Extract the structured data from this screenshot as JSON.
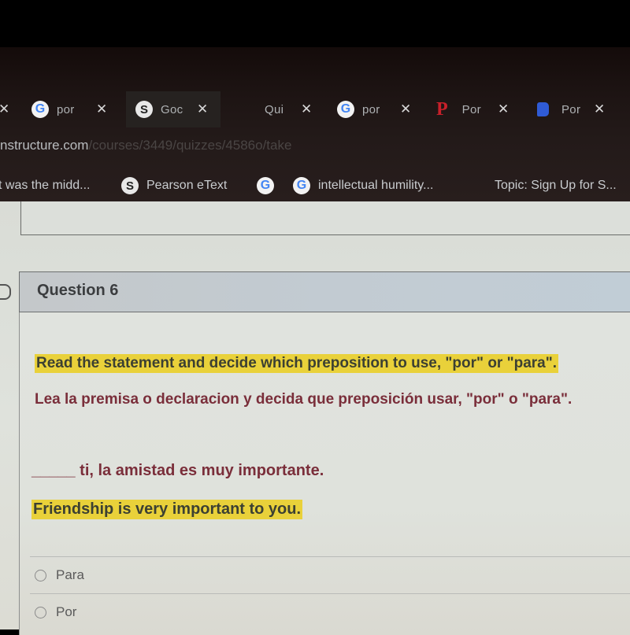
{
  "browser": {
    "tabs": [
      {
        "icon": "close-icon",
        "title": ""
      },
      {
        "icon": "google-icon",
        "title": "por"
      },
      {
        "icon": "globe-icon",
        "title": "Goc"
      },
      {
        "icon": "",
        "title": "Qui"
      },
      {
        "icon": "google-icon",
        "title": "por"
      },
      {
        "icon": "pinterest-icon",
        "title": "Por"
      },
      {
        "icon": "bookmark-blue-icon",
        "title": "Por"
      }
    ],
    "close_glyph": "✕",
    "address_bar": {
      "host": "nstructure.com",
      "path": "/courses/3449/quizzes/4586o/take"
    },
    "bookmarks": [
      {
        "icon": "",
        "label": "t was the midd..."
      },
      {
        "icon": "globe-icon",
        "label": "Pearson eText"
      },
      {
        "icon": "google-icon",
        "label": ""
      },
      {
        "icon": "google-icon",
        "label": "intellectual humility..."
      },
      {
        "icon": "",
        "label": "Topic: Sign Up for S..."
      }
    ]
  },
  "quiz": {
    "question_title": "Question 6",
    "instruction_en": "Read the statement and decide which preposition to use, \"por\" or \"para\".",
    "instruction_es": "Lea la premisa o declaracion y decida que preposición usar, \"por\" o \"para\".",
    "sentence": "_____ ti, la amistad es muy importante.",
    "translation": "Friendship is very important to you.",
    "answers": [
      {
        "label": "Para",
        "selected": false
      },
      {
        "label": "Por",
        "selected": false
      }
    ]
  },
  "colors": {
    "highlight": "#e9d13a",
    "spanish_text": "#7a2e3a",
    "header_bg": "#c2cbd2"
  }
}
